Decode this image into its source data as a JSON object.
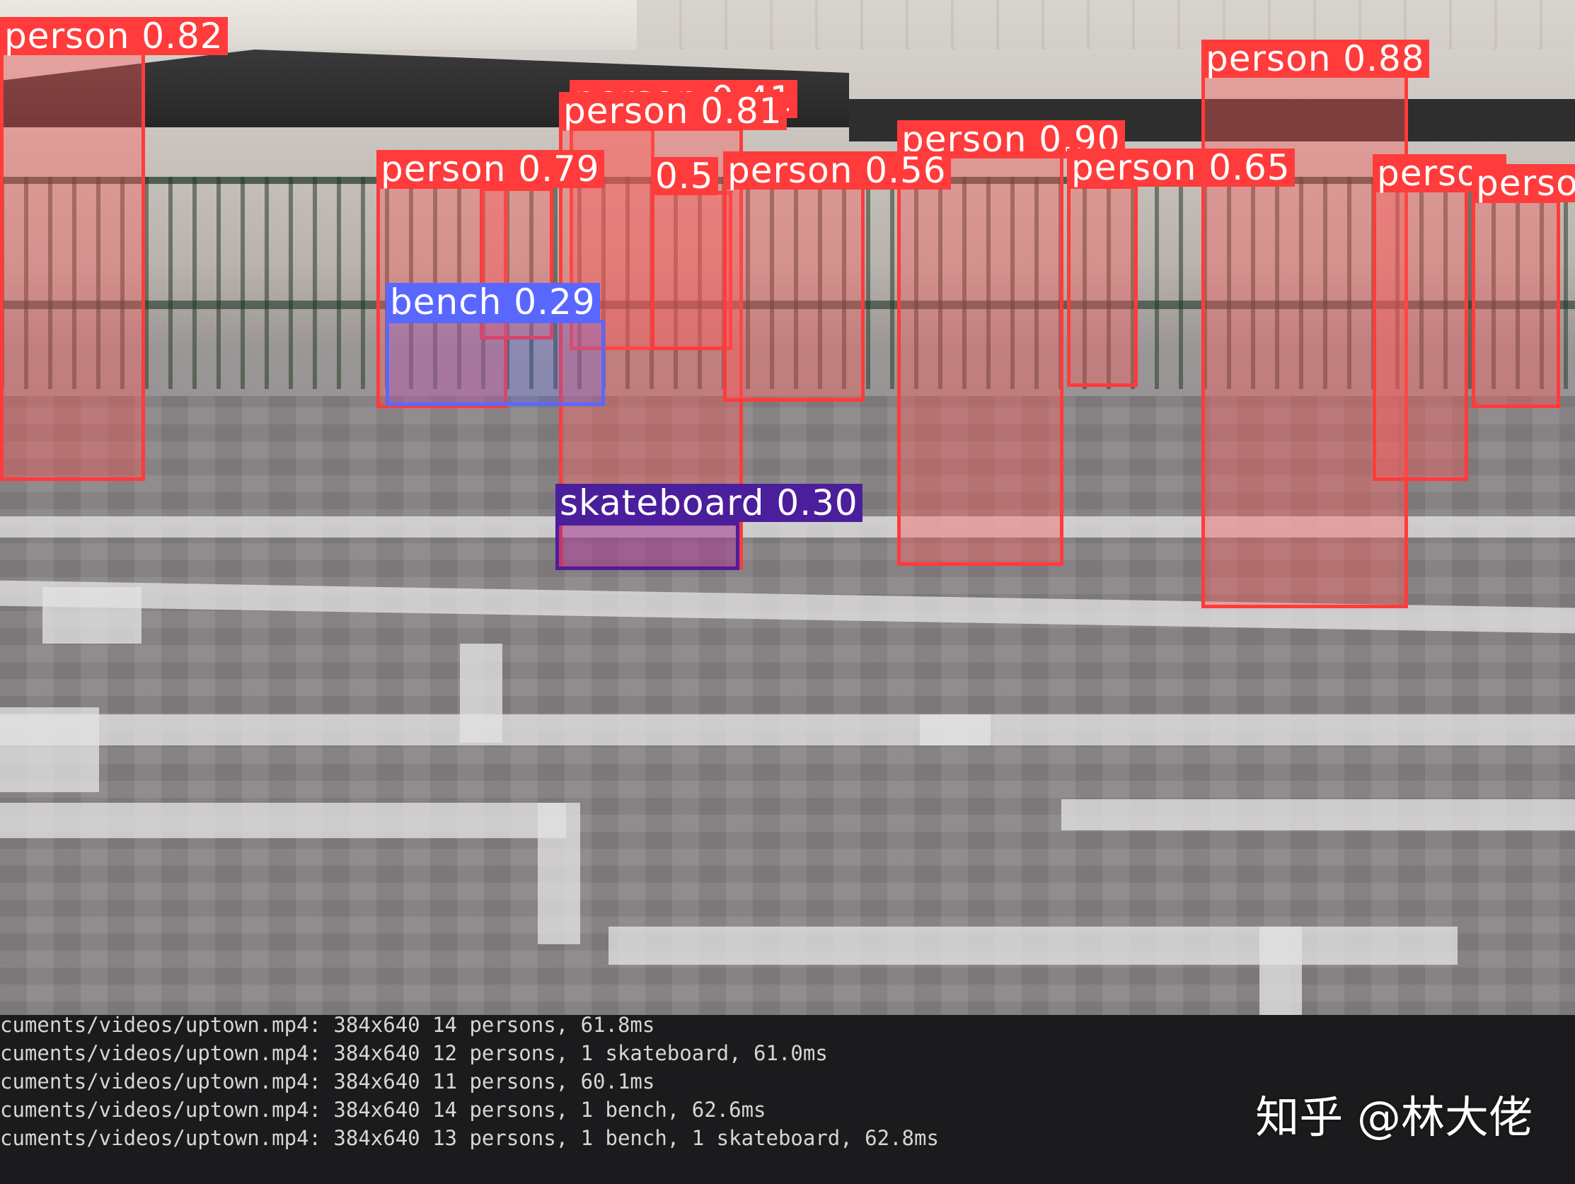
{
  "detections": [
    {
      "label": "person 0.82",
      "kind": "person"
    },
    {
      "label": "person 0.88",
      "kind": "person"
    },
    {
      "label": "person 0.41",
      "kind": "person"
    },
    {
      "label": "person 0.81",
      "kind": "person"
    },
    {
      "label": "person 0.90",
      "kind": "person"
    },
    {
      "label": "person 0.79",
      "kind": "person"
    },
    {
      "label": "0.5",
      "kind": "person"
    },
    {
      "label": "person 0.56",
      "kind": "person"
    },
    {
      "label": "person 0.65",
      "kind": "person"
    },
    {
      "label": "person",
      "kind": "person"
    },
    {
      "label": "perso",
      "kind": "person"
    },
    {
      "label": "bench 0.29",
      "kind": "bench"
    },
    {
      "label": "skateboard 0.30",
      "kind": "skateboard"
    }
  ],
  "terminal": {
    "lines": [
      "cuments/videos/uptown.mp4: 384x640 14 persons, 61.8ms",
      "cuments/videos/uptown.mp4: 384x640 12 persons, 1 skateboard, 61.0ms",
      "cuments/videos/uptown.mp4: 384x640 11 persons, 60.1ms",
      "cuments/videos/uptown.mp4: 384x640 14 persons, 1 bench, 62.6ms",
      "cuments/videos/uptown.mp4: 384x640 13 persons, 1 bench, 1 skateboard, 62.8ms"
    ]
  },
  "watermark": "知乎 @林大佬",
  "colors": {
    "person": "#ff3b3b",
    "bench": "#5a67ff",
    "skateboard": "#4b1e9b",
    "terminal_bg": "#1b1b1d"
  }
}
